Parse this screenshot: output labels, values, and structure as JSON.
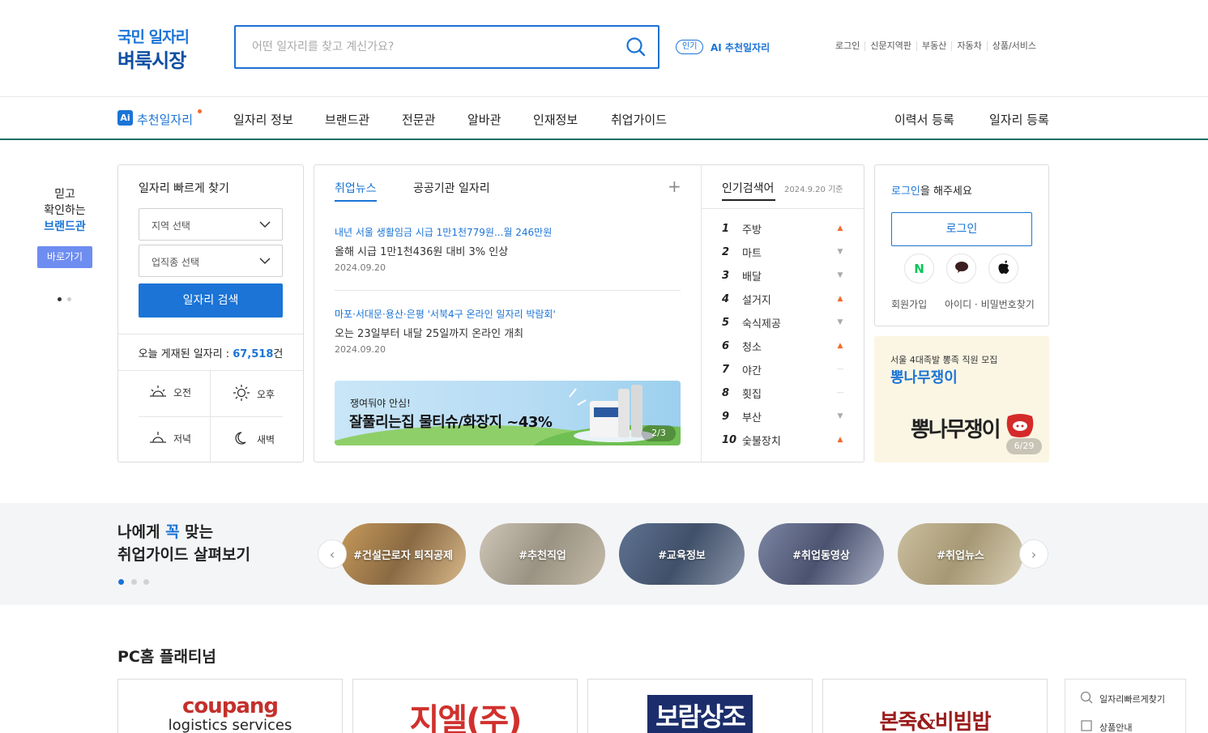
{
  "header": {
    "logo_line1": "국민 일자리",
    "logo_line2": "벼룩시장",
    "search_placeholder": "어떤 일자리를 찾고 계신가요?",
    "ai_badge": "인기",
    "ai_link": "AI 추천일자리",
    "top_links": [
      "로그인",
      "신문지역판",
      "부동산",
      "자동차",
      "상품/서비스"
    ]
  },
  "nav": {
    "ai_badge": "Ai",
    "ai_label": "추천일자리",
    "items": [
      "일자리 정보",
      "브랜드관",
      "전문관",
      "알바관",
      "인재정보",
      "취업가이드"
    ],
    "right": [
      "이력서 등록",
      "일자리 등록"
    ]
  },
  "brand_banner": {
    "line1": "믿고",
    "line2": "확인하는",
    "line3": "브랜드관",
    "button": "바로가기"
  },
  "quick_search": {
    "title": "일자리 빠르게 찾기",
    "region_select": "지역 선택",
    "industry_select": "업직종 선택",
    "search_button": "일자리 검색",
    "today_label": "오늘 게재된 일자리 : ",
    "today_count": "67,518",
    "today_unit": "건",
    "times": [
      "오전",
      "오후",
      "저녁",
      "새벽"
    ]
  },
  "news": {
    "tabs": [
      "취업뉴스",
      "공공기관 일자리"
    ],
    "plus": "+",
    "items": [
      {
        "title": "내년 서울 생활임금 시급 1만1천779원...월 246만원",
        "sub": "올해 시급 1만1천436원 대비 3% 인상",
        "date": "2024.09.20"
      },
      {
        "title": "마포·서대문·용산·은평 '서북4구 온라인 일자리 박람회'",
        "sub": "오는 23일부터 내달 25일까지 온라인 개최",
        "date": "2024.09.20"
      }
    ],
    "ad_line1": "쟁여둬야 안심!",
    "ad_line2": "잘풀리는집 물티슈/화장지 ~43%",
    "ad_counter": "2/3"
  },
  "popular": {
    "title": "인기검색어",
    "date": "2024.9.20 기준",
    "items": [
      {
        "rank": "1",
        "term": "주방",
        "trend": "up"
      },
      {
        "rank": "2",
        "term": "마트",
        "trend": "down"
      },
      {
        "rank": "3",
        "term": "배달",
        "trend": "down"
      },
      {
        "rank": "4",
        "term": "설거지",
        "trend": "up"
      },
      {
        "rank": "5",
        "term": "숙식제공",
        "trend": "down"
      },
      {
        "rank": "6",
        "term": "청소",
        "trend": "up"
      },
      {
        "rank": "7",
        "term": "야간",
        "trend": "same"
      },
      {
        "rank": "8",
        "term": "횟집",
        "trend": "same"
      },
      {
        "rank": "9",
        "term": "부산",
        "trend": "down"
      },
      {
        "rank": "10",
        "term": "숯불장치",
        "trend": "up"
      }
    ]
  },
  "login": {
    "prompt_link": "로그인",
    "prompt_rest": "을 해주세요",
    "button": "로그인",
    "signup": "회원가입",
    "find": "아이디 · 비밀번호찾기",
    "social_naver": "N"
  },
  "side_ad": {
    "line1": "서울 4대족발 뽕족 직원 모집",
    "line2": "뽕나무쟁이",
    "logo_text": "뽕나무쟁이",
    "counter": "6/29"
  },
  "guide": {
    "title_pre": "나에게 ",
    "title_hl": "꼭",
    "title_post": " 맞는",
    "title_line2": "취업가이드 살펴보기",
    "tags": [
      "#건설근로자 퇴직공제",
      "#추천직업",
      "#교육정보",
      "#취업동영상",
      "#취업뉴스"
    ]
  },
  "platinum": {
    "title": "PC홈 플래티넘",
    "cards": [
      "coupang",
      "지엘(주)",
      "보람상조",
      "본죽&비빔밥"
    ],
    "card_sub": "logistics services"
  },
  "side_float": {
    "item1": "일자리빠르게찾기",
    "item2": "상품안내"
  },
  "colors": {
    "brand_blue": "#1b74d6",
    "nav_line": "#1e6f63",
    "up": "#f26a2a"
  }
}
